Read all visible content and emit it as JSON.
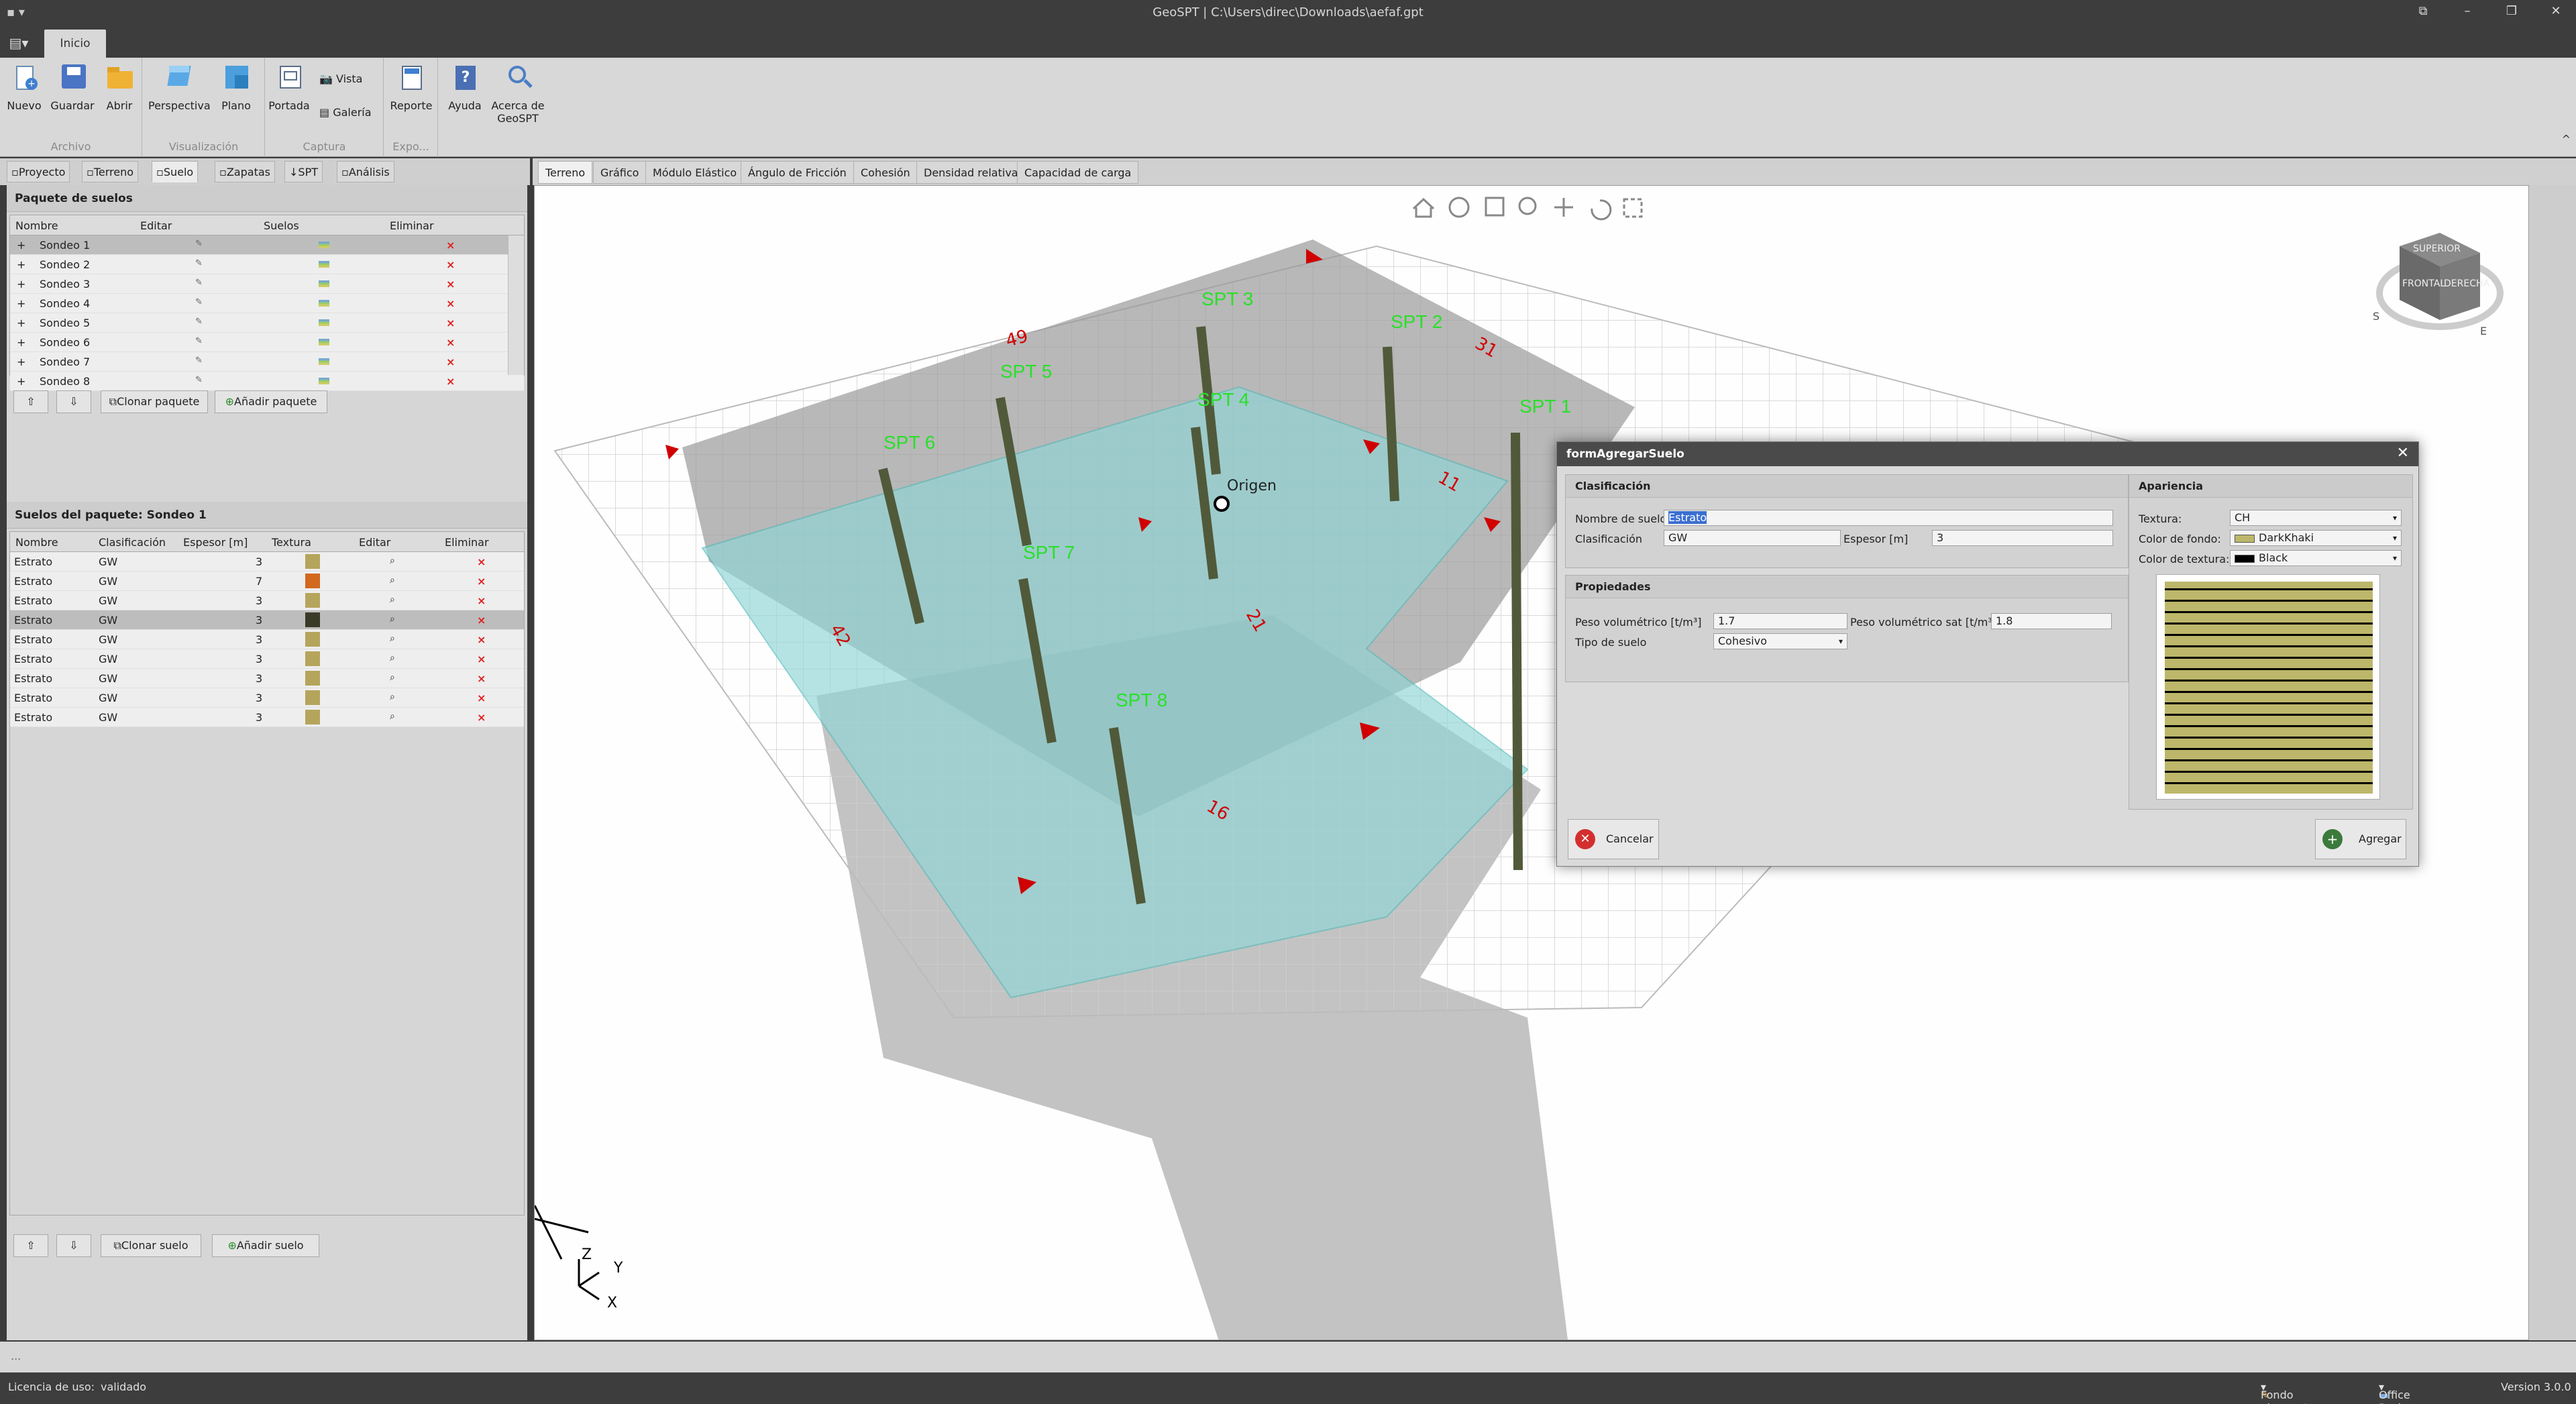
{
  "window": {
    "title": "GeoSPT  |  C:\\Users\\direc\\Downloads\\aefaf.gpt"
  },
  "ribbon": {
    "tab_inicio": "Inicio",
    "groups": {
      "archivo": "Archivo",
      "visualizacion": "Visualización",
      "captura": "Captura",
      "export": "Expo..."
    },
    "buttons": {
      "nuevo": "Nuevo",
      "guardar": "Guardar",
      "abrir": "Abrir",
      "perspectiva": "Perspectiva",
      "plano": "Plano",
      "portada": "Portada",
      "vista": "Vista",
      "galeria": "Galería",
      "reporte": "Reporte",
      "ayuda": "Ayuda",
      "acerca1": "Acerca de",
      "acerca2": "GeoSPT"
    }
  },
  "left_tabs": [
    "Proyecto",
    "Terreno",
    "Suelo",
    "Zapatas",
    "SPT",
    "Análisis"
  ],
  "paquete": {
    "title": "Paquete de suelos",
    "headers": [
      "Nombre",
      "Editar",
      "Suelos",
      "Eliminar"
    ],
    "rows": [
      "Sondeo 1",
      "Sondeo 2",
      "Sondeo 3",
      "Sondeo 4",
      "Sondeo 5",
      "Sondeo 6",
      "Sondeo 7",
      "Sondeo 8"
    ],
    "btn_clonar": "Clonar paquete",
    "btn_anadir": "Añadir paquete"
  },
  "suelos": {
    "title": "Suelos del paquete: Sondeo 1",
    "headers": [
      "Nombre",
      "Clasificación",
      "Espesor [m]",
      "Textura",
      "Editar",
      "Eliminar"
    ],
    "rows": [
      {
        "nombre": "Estrato",
        "clas": "GW",
        "esp": "3",
        "color": "#b5a55c"
      },
      {
        "nombre": "Estrato",
        "clas": "GW",
        "esp": "7",
        "color": "#d2691e"
      },
      {
        "nombre": "Estrato",
        "clas": "GW",
        "esp": "3",
        "color": "#b5a55c"
      },
      {
        "nombre": "Estrato",
        "clas": "GW",
        "esp": "3",
        "color": "#3a3a28"
      },
      {
        "nombre": "Estrato",
        "clas": "GW",
        "esp": "3",
        "color": "#b5a55c"
      },
      {
        "nombre": "Estrato",
        "clas": "GW",
        "esp": "3",
        "color": "#b5a55c"
      },
      {
        "nombre": "Estrato",
        "clas": "GW",
        "esp": "3",
        "color": "#b5a55c"
      },
      {
        "nombre": "Estrato",
        "clas": "GW",
        "esp": "3",
        "color": "#b5a55c"
      },
      {
        "nombre": "Estrato",
        "clas": "GW",
        "esp": "3",
        "color": "#b5a55c"
      }
    ],
    "btn_clonar": "Clonar suelo",
    "btn_anadir": "Añadir suelo"
  },
  "view_tabs": [
    "Terreno",
    "Gráfico",
    "Módulo Elástico",
    "Ángulo de Fricción",
    "Cohesión",
    "Densidad relativa",
    "Capacidad de carga"
  ],
  "scene": {
    "spt_labels": [
      "SPT 1",
      "SPT 2",
      "SPT 3",
      "SPT 4",
      "SPT 5",
      "SPT 6",
      "SPT 7",
      "SPT 8"
    ],
    "origin_label": "Origen",
    "dims": [
      "49",
      "31",
      "11",
      "21",
      "42",
      "16"
    ],
    "axis": {
      "z": "Z",
      "y": "Y",
      "x": "X"
    },
    "cube_faces": {
      "top": "SUPERIOR",
      "front": "FRONTAL",
      "right": "DERECHA"
    },
    "compass": {
      "s": "S",
      "e": "E"
    }
  },
  "dialog": {
    "title": "formAgregarSuelo",
    "clasificacion_title": "Clasificación",
    "nombre_label": "Nombre de suelo",
    "nombre_value": "Estrato",
    "clasificacion_label": "Clasificación",
    "clasificacion_value": "GW",
    "espesor_label": "Espesor [m]",
    "espesor_value": "3",
    "propiedades_title": "Propiedades",
    "peso_label": "Peso volumétrico [t/m³]",
    "peso_value": "1.7",
    "peso_sat_label": "Peso volumétrico sat [t/m³]",
    "peso_sat_value": "1.8",
    "tipo_label": "Tipo de suelo",
    "tipo_value": "Cohesivo",
    "apariencia_title": "Apariencia",
    "textura_label": "Textura:",
    "textura_value": "CH",
    "fondo_label": "Color de fondo:",
    "fondo_value": "DarkKhaki",
    "fondo_color": "#bdb76b",
    "tex_color_label": "Color de textura:",
    "tex_color_value": "Black",
    "tex_color": "#000000",
    "btn_cancelar": "Cancelar",
    "btn_agregar": "Agregar"
  },
  "status": {
    "dots": "...",
    "licencia_label": "Licencia de uso:",
    "licencia_value": "validado",
    "fondo": "Fondo viewport",
    "tema": "Office Dark Gray",
    "version": "Version 3.0.0"
  }
}
